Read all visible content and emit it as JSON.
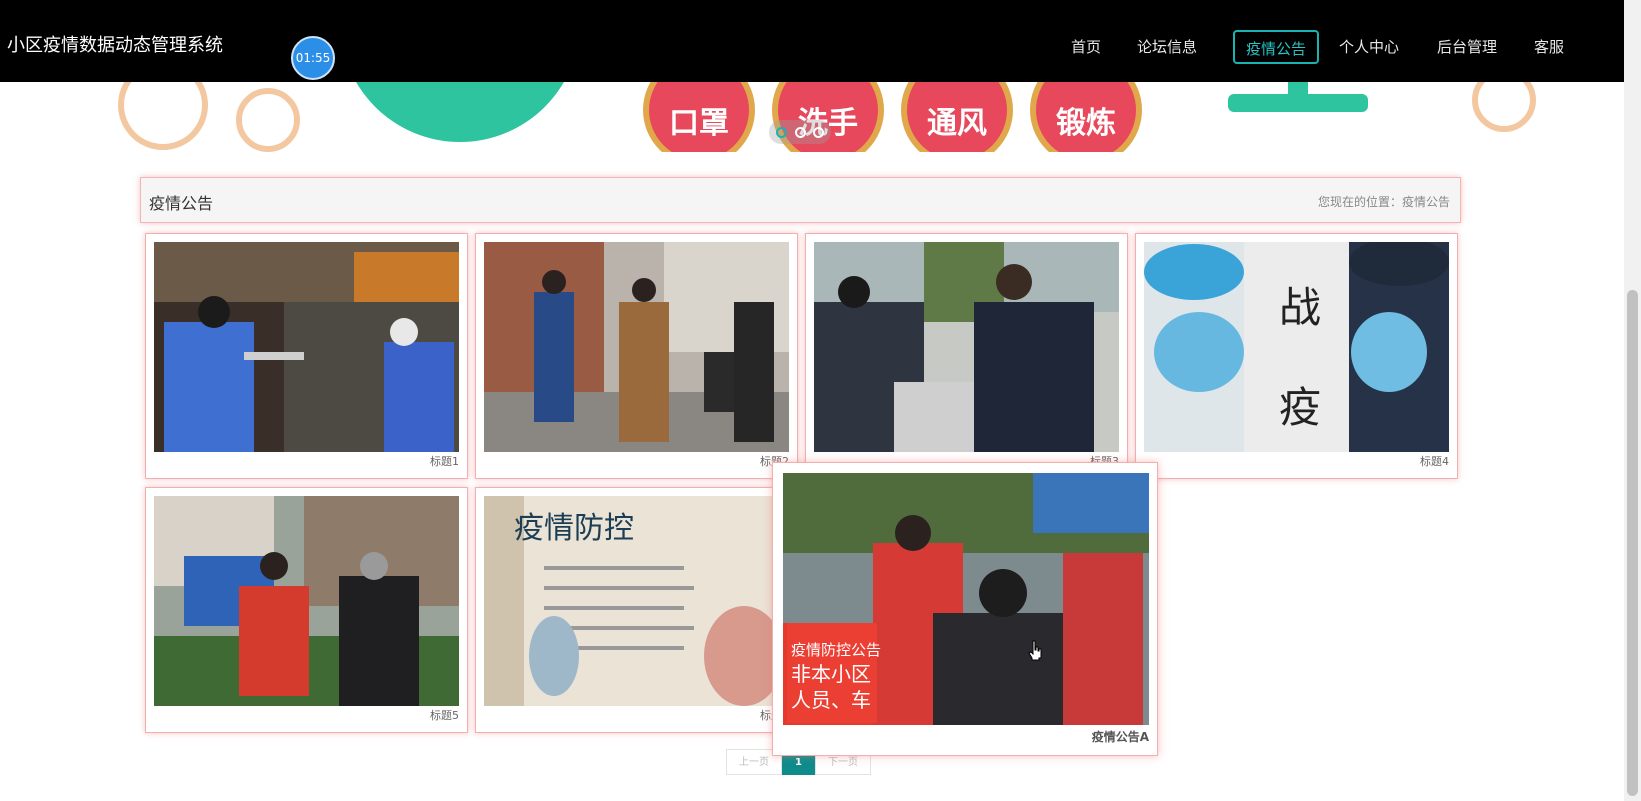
{
  "header": {
    "brand": "小区疫情数据动态管理系统",
    "timer": "01:55",
    "nav": [
      {
        "label": "首页"
      },
      {
        "label": "论坛信息"
      },
      {
        "label": "疫情公告"
      },
      {
        "label": "个人中心"
      },
      {
        "label": "后台管理"
      },
      {
        "label": "客服"
      }
    ],
    "active_nav": "疫情公告"
  },
  "banner": {
    "badges": [
      "口罩",
      "洗手",
      "通风",
      "锻炼"
    ],
    "slides": 3,
    "active_slide": 1
  },
  "section": {
    "title": "疫情公告",
    "breadcrumb": "您现在的位置：疫情公告"
  },
  "cards": [
    {
      "caption": "标题1"
    },
    {
      "caption": "标题2"
    },
    {
      "caption": "标题3"
    },
    {
      "caption": "标题4"
    },
    {
      "caption": "标题5"
    },
    {
      "caption": "标题6"
    }
  ],
  "hover_card": {
    "caption": "疫情公告A"
  },
  "pagination": {
    "prev": "上一页",
    "current": "1",
    "next": "下一页"
  },
  "colors": {
    "nav_bg": "#000000",
    "accent": "#1ab3b3",
    "page_active": "#0e8c8c",
    "card_border": "#f0b0b0"
  }
}
